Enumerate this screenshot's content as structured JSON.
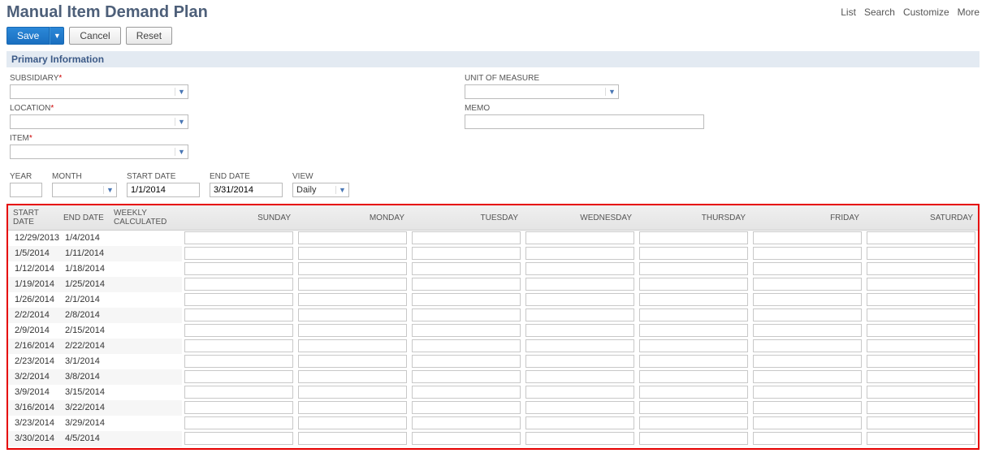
{
  "header": {
    "title": "Manual Item Demand Plan",
    "links": [
      "List",
      "Search",
      "Customize",
      "More"
    ]
  },
  "actions": {
    "save": "Save",
    "cancel": "Cancel",
    "reset": "Reset"
  },
  "section": {
    "primary": "Primary Information"
  },
  "fields": {
    "subsidiary": {
      "label": "SUBSIDIARY",
      "value": ""
    },
    "location": {
      "label": "LOCATION",
      "value": ""
    },
    "item": {
      "label": "ITEM",
      "value": ""
    },
    "uom": {
      "label": "UNIT OF MEASURE",
      "value": ""
    },
    "memo": {
      "label": "MEMO",
      "value": ""
    }
  },
  "filters": {
    "year": {
      "label": "YEAR",
      "value": ""
    },
    "month": {
      "label": "MONTH",
      "value": ""
    },
    "start_date": {
      "label": "START DATE",
      "value": "1/1/2014"
    },
    "end_date": {
      "label": "END DATE",
      "value": "3/31/2014"
    },
    "view": {
      "label": "VIEW",
      "value": "Daily"
    }
  },
  "grid": {
    "columns": [
      "START DATE",
      "END DATE",
      "WEEKLY CALCULATED",
      "SUNDAY",
      "MONDAY",
      "TUESDAY",
      "WEDNESDAY",
      "THURSDAY",
      "FRIDAY",
      "SATURDAY"
    ],
    "rows": [
      {
        "start": "12/29/2013",
        "end": "1/4/2014"
      },
      {
        "start": "1/5/2014",
        "end": "1/11/2014"
      },
      {
        "start": "1/12/2014",
        "end": "1/18/2014"
      },
      {
        "start": "1/19/2014",
        "end": "1/25/2014"
      },
      {
        "start": "1/26/2014",
        "end": "2/1/2014"
      },
      {
        "start": "2/2/2014",
        "end": "2/8/2014"
      },
      {
        "start": "2/9/2014",
        "end": "2/15/2014"
      },
      {
        "start": "2/16/2014",
        "end": "2/22/2014"
      },
      {
        "start": "2/23/2014",
        "end": "3/1/2014"
      },
      {
        "start": "3/2/2014",
        "end": "3/8/2014"
      },
      {
        "start": "3/9/2014",
        "end": "3/15/2014"
      },
      {
        "start": "3/16/2014",
        "end": "3/22/2014"
      },
      {
        "start": "3/23/2014",
        "end": "3/29/2014"
      },
      {
        "start": "3/30/2014",
        "end": "4/5/2014"
      }
    ]
  }
}
